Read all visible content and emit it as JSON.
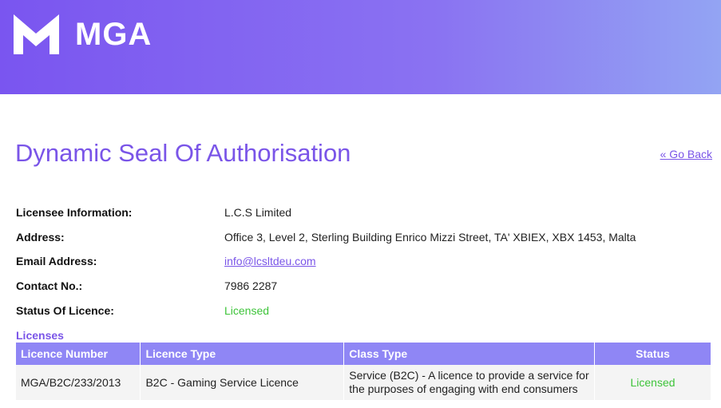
{
  "brand": {
    "name": "MGA",
    "logo_icon": "mga-logo-icon"
  },
  "page": {
    "title": "Dynamic Seal Of Authorisation",
    "go_back": "« Go Back"
  },
  "info": {
    "licensee_label": "Licensee Information:",
    "licensee_value": "L.C.S Limited",
    "address_label": "Address:",
    "address_value": "Office 3, Level 2, Sterling Building Enrico Mizzi Street, TA' XBIEX, XBX 1453, Malta",
    "email_label": "Email Address:",
    "email_value": "info@lcsltdeu.com",
    "contact_label": "Contact No.:",
    "contact_value": "7986 2287",
    "status_label": "Status Of Licence:",
    "status_value": "Licensed"
  },
  "licenses": {
    "section_title": "Licenses",
    "headers": [
      "Licence Number",
      "Licence Type",
      "Class Type",
      "Status"
    ],
    "rows": [
      {
        "number": "MGA/B2C/233/2013",
        "type": "B2C - Gaming Service Licence",
        "class_type": "Service (B2C) - A licence to provide a service for the purposes of engaging with end consumers",
        "status": "Licensed"
      }
    ]
  },
  "colors": {
    "accent": "#7a55e8",
    "header_gradient_start": "#7a55f0",
    "header_gradient_end": "#93a4f3",
    "table_header": "#8f86f5",
    "status_green": "#3ec43a"
  }
}
